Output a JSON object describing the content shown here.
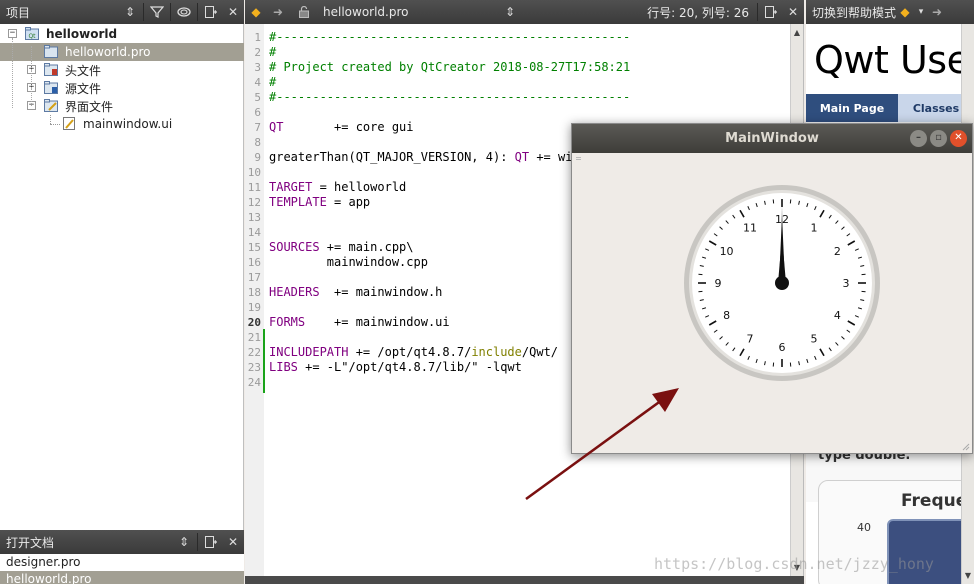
{
  "projects_panel": {
    "title": "项目",
    "tree": {
      "root": "helloworld",
      "items": [
        {
          "label": "helloworld.pro"
        },
        {
          "label": "头文件"
        },
        {
          "label": "源文件"
        },
        {
          "label": "界面文件"
        },
        {
          "label": "mainwindow.ui"
        }
      ]
    }
  },
  "open_docs": {
    "title": "打开文档",
    "items": [
      "designer.pro",
      "helloworld.pro"
    ]
  },
  "editor": {
    "file_selector": "helloworld.pro",
    "cursor_position": "行号: 20, 列号: 26",
    "current_line": 20
  },
  "help_pane": {
    "mode_button": "切换到帮助模式",
    "title": "Qwt Use",
    "nav_tabs": [
      "Main Page",
      "Classes"
    ],
    "body_text": "type double.",
    "chart_title": "Frequen",
    "axis_tick": "40"
  },
  "main_window": {
    "title": "MainWindow",
    "clock": {
      "numbers": [
        "12",
        "1",
        "2",
        "3",
        "4",
        "5",
        "6",
        "7",
        "8",
        "9",
        "10",
        "11"
      ],
      "hour_hand": 12,
      "minute_hand": 0,
      "second_hand": 0
    }
  },
  "watermark": "https://blog.csdn.net/jzzy_hony",
  "colors": {
    "selection": "#a29f93",
    "comment": "#008000",
    "keyword": "#800080",
    "help_nav": "#2f4e7e"
  }
}
